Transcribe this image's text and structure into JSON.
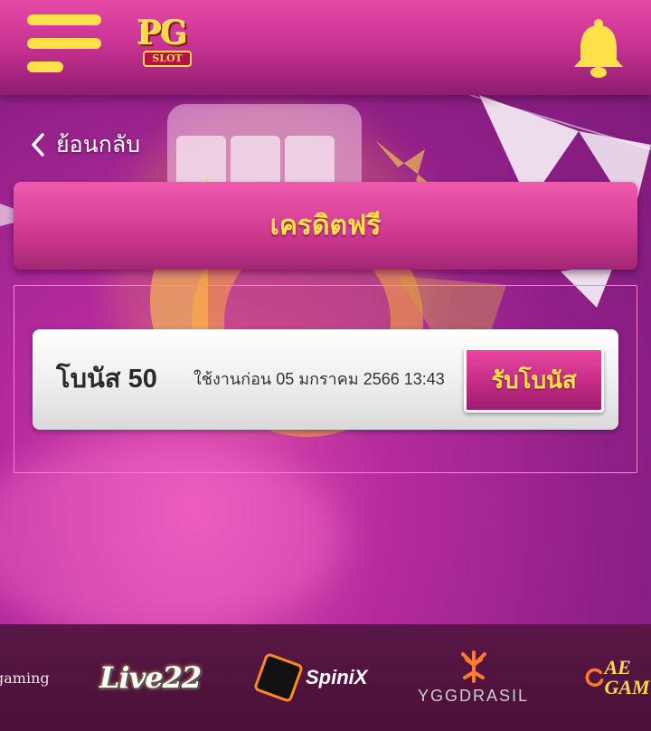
{
  "header": {
    "logo_text": "PG",
    "logo_sub": "SLOT"
  },
  "nav": {
    "back_label": "ย้อนกลับ"
  },
  "page": {
    "title": "เครดิตฟรี"
  },
  "bonuses": [
    {
      "name": "โบนัส 50",
      "expiry": "ใช้งานก่อน 05 มกราคม 2566 13:43",
      "claim_label": "รับโบนัส"
    }
  ],
  "providers": [
    {
      "label": "gaming"
    },
    {
      "label": "Live22"
    },
    {
      "label": "SpiniX"
    },
    {
      "label": "YGGDRASIL"
    },
    {
      "label": "AE GAM"
    }
  ],
  "colors": {
    "accent_yellow": "#ffe14a",
    "header_pink": "#d33c94",
    "background_purple": "#8e1f86"
  },
  "icons": {
    "menu": "hamburger-icon",
    "notifications": "bell-icon",
    "back": "chevron-left-icon"
  }
}
